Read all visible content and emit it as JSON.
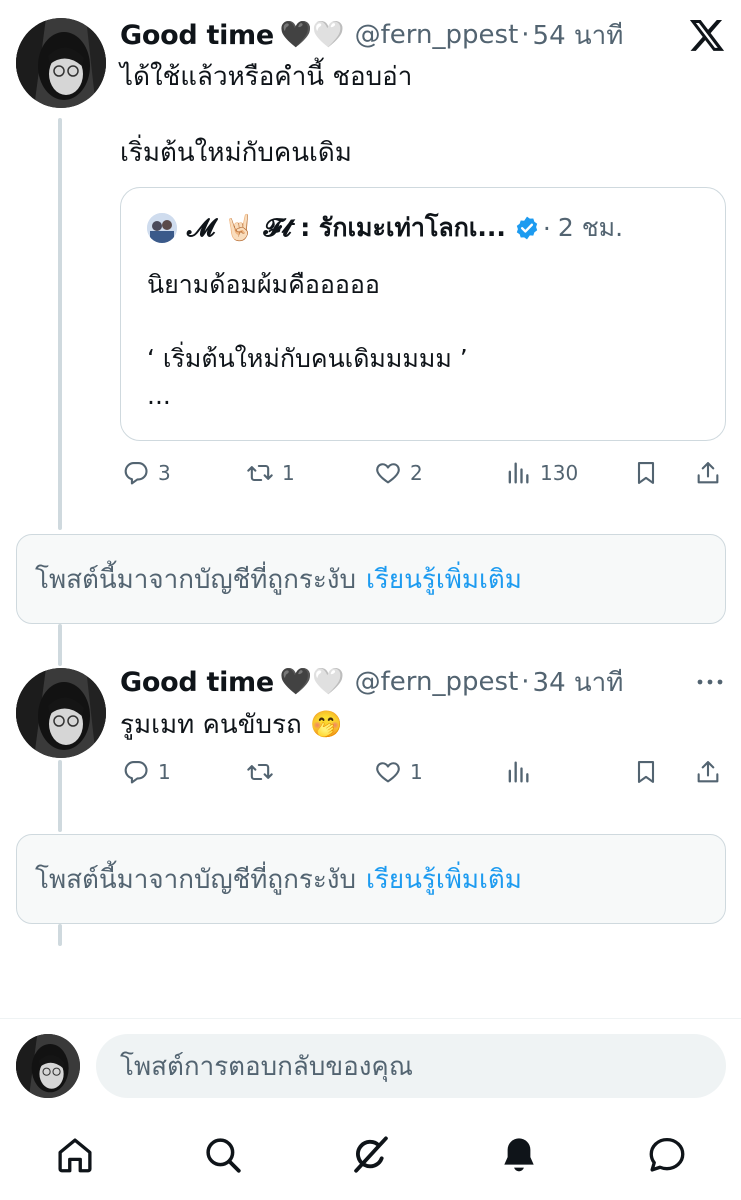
{
  "posts": [
    {
      "display_name": "Good time",
      "hearts": "🖤🤍",
      "handle": "@fern_ppest",
      "separator": "·",
      "time": "54 นาที",
      "text": "ได้ใช้แล้วหรือคำนี้ ชอบอ่า\n\nเริ่มต้นใหม่กับคนเดิม",
      "quote": {
        "name": "𝓜 🤘🏻 𝓕𝓽 : รักเมะเท่าโลกเ...",
        "separator": "·",
        "time": "2 ชม.",
        "text": "นิยามด้อมผ้มคือออออ\n\n‘ เริ่มต้นใหม่กับคนเดิมมมมม ’\n..."
      },
      "actions": {
        "replies": "3",
        "reposts": "1",
        "likes": "2",
        "views": "130"
      }
    },
    {
      "display_name": "Good time",
      "hearts": "🖤🤍",
      "handle": "@fern_ppest",
      "separator": "·",
      "time": "34 นาที",
      "text": "รูมเมท คนขับรถ 🤭",
      "actions": {
        "replies": "1",
        "reposts": "",
        "likes": "1",
        "views": ""
      }
    }
  ],
  "notice": {
    "text": "โพสต์นี้มาจากบัญชีที่ถูกระงับ",
    "link": "เรียนรู้เพิ่มเติม"
  },
  "reply_bar": {
    "placeholder": "โพสต์การตอบกลับของคุณ"
  },
  "icons": {
    "close": "x-logo-icon",
    "more": "more-icon",
    "reply": "reply-icon",
    "repost": "repost-icon",
    "like": "heart-icon",
    "views": "views-icon",
    "bookmark": "bookmark-icon",
    "share": "share-icon",
    "verified": "verified-badge-icon",
    "nav": [
      "home-icon",
      "search-icon",
      "grok-icon",
      "notifications-icon",
      "messages-icon"
    ]
  },
  "colors": {
    "link": "#1d9bf0",
    "muted": "#536471",
    "verified": "#1d9bf0"
  }
}
